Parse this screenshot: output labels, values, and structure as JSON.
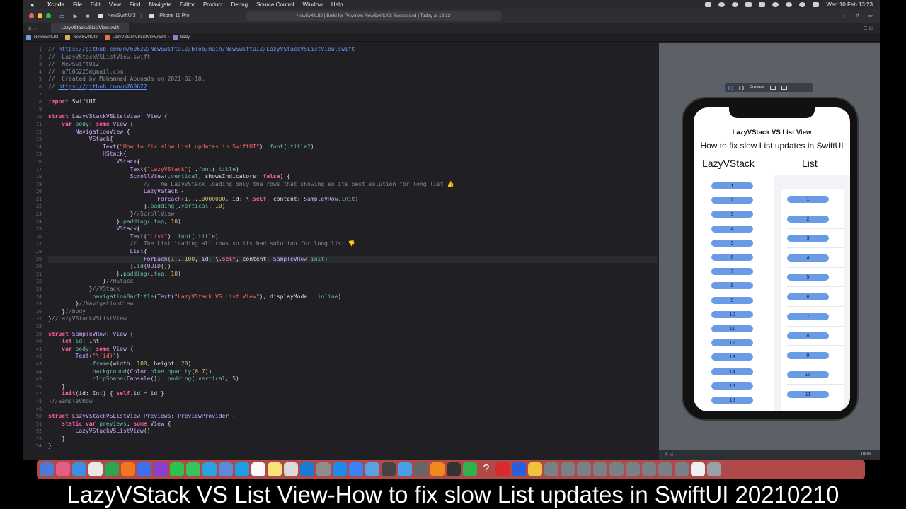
{
  "menubar": {
    "app": "Xcode",
    "items": [
      "File",
      "Edit",
      "View",
      "Find",
      "Navigate",
      "Editor",
      "Product",
      "Debug",
      "Source Control",
      "Window",
      "Help"
    ],
    "clock": "Wed 10 Feb  13:23"
  },
  "titlebar": {
    "scheme": "NewSwiftUI2",
    "device": "iPhone 11 Pro",
    "status": "NewSwiftUI2 | Build for Previews NewSwiftUI2: Succeeded | Today at 13:13"
  },
  "tab": {
    "label": "LazyVStackVSListView.swift"
  },
  "breadcrumb": [
    "NewSwiftUI2",
    "NewSwiftUI2",
    "LazyVStackVSListView.swift",
    "body"
  ],
  "code_lines": [
    [
      [
        "c-com",
        "// "
      ],
      [
        "c-link",
        "https://github.com/m760622/NewSwiftUI2/blob/main/NewSwiftUI2/LazyVStackVSListView.swift"
      ]
    ],
    [
      [
        "c-com",
        "//  LazyVStackVSListView.swift"
      ]
    ],
    [
      [
        "c-com",
        "//  NewSwiftUI2"
      ]
    ],
    [
      [
        "c-com",
        "//  m7606225@gmail.com"
      ]
    ],
    [
      [
        "c-com",
        "//  Created by Mohammed Abunada on 2021-02-10."
      ]
    ],
    [
      [
        "c-com",
        "// "
      ],
      [
        "c-link",
        "https://github.com/m760622"
      ]
    ],
    [],
    [
      [
        "c-kw",
        "import"
      ],
      [
        "c-plain",
        " SwiftUI"
      ]
    ],
    [],
    [
      [
        "c-kw",
        "struct"
      ],
      [
        "c-plain",
        " "
      ],
      [
        "c-type",
        "LazyVStackVSListView"
      ],
      [
        "c-plain",
        ": "
      ],
      [
        "c-type",
        "View"
      ],
      [
        "c-plain",
        " {"
      ]
    ],
    [
      [
        "c-plain",
        "    "
      ],
      [
        "c-kw",
        "var"
      ],
      [
        "c-plain",
        " "
      ],
      [
        "c-fn",
        "body"
      ],
      [
        "c-plain",
        ": "
      ],
      [
        "c-kw",
        "some"
      ],
      [
        "c-plain",
        " "
      ],
      [
        "c-type",
        "View"
      ],
      [
        "c-plain",
        " {"
      ]
    ],
    [
      [
        "c-plain",
        "        "
      ],
      [
        "c-type",
        "NavigationView"
      ],
      [
        "c-plain",
        " {"
      ]
    ],
    [
      [
        "c-plain",
        "            "
      ],
      [
        "c-type",
        "VStack"
      ],
      [
        "c-plain",
        "{"
      ]
    ],
    [
      [
        "c-plain",
        "                "
      ],
      [
        "c-type",
        "Text"
      ],
      [
        "c-plain",
        "("
      ],
      [
        "c-str",
        "\"How to fix slow List updates in SwiftUI\""
      ],
      [
        "c-plain",
        ") ."
      ],
      [
        "c-fn",
        "font"
      ],
      [
        "c-plain",
        "(."
      ],
      [
        "c-fn",
        "title2"
      ],
      [
        "c-plain",
        ")"
      ]
    ],
    [
      [
        "c-plain",
        "                "
      ],
      [
        "c-type",
        "HStack"
      ],
      [
        "c-plain",
        "{"
      ]
    ],
    [
      [
        "c-plain",
        "                    "
      ],
      [
        "c-type",
        "VStack"
      ],
      [
        "c-plain",
        "{"
      ]
    ],
    [
      [
        "c-plain",
        "                        "
      ],
      [
        "c-type",
        "Text"
      ],
      [
        "c-plain",
        "("
      ],
      [
        "c-str",
        "\"LazyVStack\""
      ],
      [
        "c-plain",
        ") ."
      ],
      [
        "c-fn",
        "font"
      ],
      [
        "c-plain",
        "(."
      ],
      [
        "c-fn",
        "title"
      ],
      [
        "c-plain",
        ")"
      ]
    ],
    [
      [
        "c-plain",
        "                        "
      ],
      [
        "c-type",
        "ScrollView"
      ],
      [
        "c-plain",
        "(."
      ],
      [
        "c-fn",
        "vertical"
      ],
      [
        "c-plain",
        ", showsIndicators: "
      ],
      [
        "c-kw",
        "false"
      ],
      [
        "c-plain",
        ") {"
      ]
    ],
    [
      [
        "c-plain",
        "                            "
      ],
      [
        "c-com",
        "//  The LazyVStack loading only the rows that showing so its best solution for long list 👍"
      ]
    ],
    [
      [
        "c-plain",
        "                            "
      ],
      [
        "c-type",
        "LazyVStack"
      ],
      [
        "c-plain",
        " {"
      ]
    ],
    [
      [
        "c-plain",
        "                                "
      ],
      [
        "c-type",
        "ForEach"
      ],
      [
        "c-plain",
        "("
      ],
      [
        "c-num",
        "1"
      ],
      [
        "c-plain",
        "..."
      ],
      [
        "c-num",
        "10000000"
      ],
      [
        "c-plain",
        ", id: \\."
      ],
      [
        "c-kw",
        "self"
      ],
      [
        "c-plain",
        ", content: "
      ],
      [
        "c-type",
        "SampleVRow"
      ],
      [
        "c-plain",
        "."
      ],
      [
        "c-fn",
        "init"
      ],
      [
        "c-plain",
        ")"
      ]
    ],
    [
      [
        "c-plain",
        "                            }."
      ],
      [
        "c-fn",
        "padding"
      ],
      [
        "c-plain",
        "(."
      ],
      [
        "c-fn",
        "vertical"
      ],
      [
        "c-plain",
        ", "
      ],
      [
        "c-num",
        "10"
      ],
      [
        "c-plain",
        ")"
      ]
    ],
    [
      [
        "c-plain",
        "                        }"
      ],
      [
        "c-com",
        "//ScrollView"
      ]
    ],
    [
      [
        "c-plain",
        "                    }."
      ],
      [
        "c-fn",
        "padding"
      ],
      [
        "c-plain",
        "(."
      ],
      [
        "c-fn",
        "top"
      ],
      [
        "c-plain",
        ", "
      ],
      [
        "c-num",
        "10"
      ],
      [
        "c-plain",
        ")"
      ]
    ],
    [
      [
        "c-plain",
        "                    "
      ],
      [
        "c-type",
        "VStack"
      ],
      [
        "c-plain",
        "{"
      ]
    ],
    [
      [
        "c-plain",
        "                        "
      ],
      [
        "c-type",
        "Text"
      ],
      [
        "c-plain",
        "("
      ],
      [
        "c-str",
        "\"List\""
      ],
      [
        "c-plain",
        ") ."
      ],
      [
        "c-fn",
        "font"
      ],
      [
        "c-plain",
        "(."
      ],
      [
        "c-fn",
        "title"
      ],
      [
        "c-plain",
        ")"
      ]
    ],
    [
      [
        "c-plain",
        "                        "
      ],
      [
        "c-com",
        "//  The List loading all rows so its bad solution for long list 👎"
      ]
    ],
    [
      [
        "c-plain",
        "                        "
      ],
      [
        "c-type",
        "List"
      ],
      [
        "c-plain",
        "{"
      ]
    ],
    [
      [
        "c-plain",
        "                            "
      ],
      [
        "c-type",
        "ForEach"
      ],
      [
        "c-plain",
        "("
      ],
      [
        "c-num",
        "1"
      ],
      [
        "c-plain",
        "..."
      ],
      [
        "c-num",
        "100"
      ],
      [
        "c-plain",
        ", id: \\."
      ],
      [
        "c-kw",
        "self"
      ],
      [
        "c-plain",
        ", content: "
      ],
      [
        "c-type",
        "SampleVRow"
      ],
      [
        "c-plain",
        "."
      ],
      [
        "c-fn",
        "init"
      ],
      [
        "c-plain",
        ")"
      ]
    ],
    [
      [
        "c-plain",
        "                        }."
      ],
      [
        "c-fn",
        "id"
      ],
      [
        "c-plain",
        "("
      ],
      [
        "c-type",
        "UUID"
      ],
      [
        "c-plain",
        "())"
      ]
    ],
    [
      [
        "c-plain",
        "                    }."
      ],
      [
        "c-fn",
        "padding"
      ],
      [
        "c-plain",
        "(."
      ],
      [
        "c-fn",
        "top"
      ],
      [
        "c-plain",
        ", "
      ],
      [
        "c-num",
        "10"
      ],
      [
        "c-plain",
        ")"
      ]
    ],
    [
      [
        "c-plain",
        "                }"
      ],
      [
        "c-com",
        "//HStack"
      ]
    ],
    [
      [
        "c-plain",
        "            }"
      ],
      [
        "c-com",
        "//VStack"
      ]
    ],
    [
      [
        "c-plain",
        "            ."
      ],
      [
        "c-fn",
        "navigationBarTitle"
      ],
      [
        "c-plain",
        "("
      ],
      [
        "c-type",
        "Text"
      ],
      [
        "c-plain",
        "("
      ],
      [
        "c-str",
        "\"LazyVStack VS List View\""
      ],
      [
        "c-plain",
        "), displayMode: ."
      ],
      [
        "c-fn",
        "inline"
      ],
      [
        "c-plain",
        ")"
      ]
    ],
    [
      [
        "c-plain",
        "        }"
      ],
      [
        "c-com",
        "//NavigationView"
      ]
    ],
    [
      [
        "c-plain",
        "    }"
      ],
      [
        "c-com",
        "//body"
      ]
    ],
    [
      [
        "c-plain",
        "}"
      ],
      [
        "c-com",
        "//LazyVStackVSListView"
      ]
    ],
    [],
    [
      [
        "c-kw",
        "struct"
      ],
      [
        "c-plain",
        " "
      ],
      [
        "c-type",
        "SampleVRow"
      ],
      [
        "c-plain",
        ": "
      ],
      [
        "c-type",
        "View"
      ],
      [
        "c-plain",
        " {"
      ]
    ],
    [
      [
        "c-plain",
        "    "
      ],
      [
        "c-kw",
        "let"
      ],
      [
        "c-plain",
        " "
      ],
      [
        "c-fn",
        "id"
      ],
      [
        "c-plain",
        ": "
      ],
      [
        "c-type",
        "Int"
      ]
    ],
    [
      [
        "c-plain",
        "    "
      ],
      [
        "c-kw",
        "var"
      ],
      [
        "c-plain",
        " "
      ],
      [
        "c-fn",
        "body"
      ],
      [
        "c-plain",
        ": "
      ],
      [
        "c-kw",
        "some"
      ],
      [
        "c-plain",
        " "
      ],
      [
        "c-type",
        "View"
      ],
      [
        "c-plain",
        " {"
      ]
    ],
    [
      [
        "c-plain",
        "        "
      ],
      [
        "c-type",
        "Text"
      ],
      [
        "c-plain",
        "("
      ],
      [
        "c-str",
        "\"\\(id)\""
      ],
      [
        "c-plain",
        ")"
      ]
    ],
    [
      [
        "c-plain",
        "            ."
      ],
      [
        "c-fn",
        "frame"
      ],
      [
        "c-plain",
        "(width: "
      ],
      [
        "c-num",
        "100"
      ],
      [
        "c-plain",
        ", height: "
      ],
      [
        "c-num",
        "20"
      ],
      [
        "c-plain",
        ")"
      ]
    ],
    [
      [
        "c-plain",
        "            ."
      ],
      [
        "c-fn",
        "background"
      ],
      [
        "c-plain",
        "("
      ],
      [
        "c-type",
        "Color"
      ],
      [
        "c-plain",
        "."
      ],
      [
        "c-fn",
        "blue"
      ],
      [
        "c-plain",
        "."
      ],
      [
        "c-fn",
        "opacity"
      ],
      [
        "c-plain",
        "("
      ],
      [
        "c-num",
        "0.7"
      ],
      [
        "c-plain",
        "))"
      ]
    ],
    [
      [
        "c-plain",
        "            ."
      ],
      [
        "c-fn",
        "clipShape"
      ],
      [
        "c-plain",
        "("
      ],
      [
        "c-type",
        "Capsule"
      ],
      [
        "c-plain",
        "()) ."
      ],
      [
        "c-fn",
        "padding"
      ],
      [
        "c-plain",
        "(."
      ],
      [
        "c-fn",
        "vertical"
      ],
      [
        "c-plain",
        ", "
      ],
      [
        "c-num",
        "5"
      ],
      [
        "c-plain",
        ")"
      ]
    ],
    [
      [
        "c-plain",
        "    }"
      ]
    ],
    [
      [
        "c-plain",
        "    "
      ],
      [
        "c-kw",
        "init"
      ],
      [
        "c-plain",
        "(id: "
      ],
      [
        "c-type",
        "Int"
      ],
      [
        "c-plain",
        ") { "
      ],
      [
        "c-kw",
        "self"
      ],
      [
        "c-plain",
        ".id = id }"
      ]
    ],
    [
      [
        "c-plain",
        "}"
      ],
      [
        "c-com",
        "//SampleVRow"
      ]
    ],
    [],
    [
      [
        "c-kw",
        "struct"
      ],
      [
        "c-plain",
        " "
      ],
      [
        "c-type",
        "LazyVStackVSListView_Previews"
      ],
      [
        "c-plain",
        ": "
      ],
      [
        "c-type",
        "PreviewProvider"
      ],
      [
        "c-plain",
        " {"
      ]
    ],
    [
      [
        "c-plain",
        "    "
      ],
      [
        "c-kw",
        "static"
      ],
      [
        "c-plain",
        " "
      ],
      [
        "c-kw",
        "var"
      ],
      [
        "c-plain",
        " "
      ],
      [
        "c-fn",
        "previews"
      ],
      [
        "c-plain",
        ": "
      ],
      [
        "c-kw",
        "some"
      ],
      [
        "c-plain",
        " "
      ],
      [
        "c-type",
        "View"
      ],
      [
        "c-plain",
        " {"
      ]
    ],
    [
      [
        "c-plain",
        "        "
      ],
      [
        "c-type",
        "LazyVStackVSListView"
      ],
      [
        "c-plain",
        "()"
      ]
    ],
    [
      [
        "c-plain",
        "    }"
      ]
    ],
    [
      [
        "c-plain",
        "}"
      ]
    ]
  ],
  "current_line": 29,
  "preview": {
    "toolbar_label": "Preview",
    "nav_title": "LazyVStack VS List View",
    "headline": "How to fix slow List updates in SwiftUI",
    "lazy_title": "LazyVStack",
    "list_title": "List",
    "lazy_rows": [
      "1",
      "2",
      "3",
      "4",
      "5",
      "6",
      "7",
      "8",
      "9",
      "10",
      "11",
      "12",
      "13",
      "14",
      "15",
      "16"
    ],
    "list_rows": [
      "1",
      "2",
      "3",
      "4",
      "5",
      "6",
      "7",
      "8",
      "9",
      "10",
      "11"
    ],
    "zoom": "100%"
  },
  "colors": {
    "capsule": "#6a9be6",
    "dock": "#b04a48"
  },
  "dock_icons": [
    "finder-icon",
    "launchpad-icon",
    "safari-icon",
    "chrome-icon",
    "facetime-icon",
    "firefox-icon",
    "app-icon",
    "podcast-icon",
    "whatsapp-icon",
    "messages-icon",
    "telegram-icon",
    "chat-icon",
    "skype-icon",
    "calendar-icon",
    "notes-icon",
    "preview-icon",
    "xcode-icon",
    "settings-icon",
    "appstore-icon",
    "xcode-tools-icon",
    "network-icon",
    "app-icon",
    "screen-icon",
    "app-icon",
    "vlc-icon",
    "terminal-icon",
    "numbers-icon",
    "help-icon",
    "acrobat-icon",
    "instruments-icon",
    "pen-icon",
    "window-icon",
    "window-icon",
    "window-icon",
    "window-icon",
    "window-icon",
    "window-icon",
    "window-icon",
    "window-icon",
    "window-icon",
    "document-icon",
    "trash-icon"
  ],
  "caption": "LazyVStack VS List View-How to fix slow List updates in SwiftUI 20210210"
}
